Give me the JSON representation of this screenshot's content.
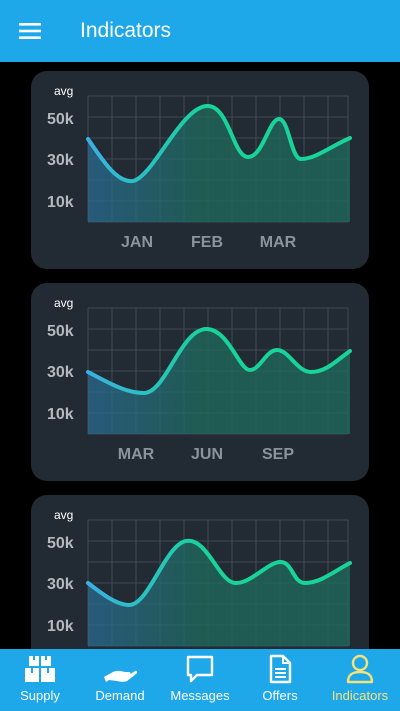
{
  "app": {
    "title": "Indicators"
  },
  "charts": [
    {
      "label": "avg",
      "ticks": [
        "50k",
        "30k",
        "10k"
      ],
      "months": [
        "JAN",
        "FEB",
        "MAR"
      ]
    },
    {
      "label": "avg",
      "ticks": [
        "50k",
        "30k",
        "10k"
      ],
      "months": [
        "MAR",
        "JUN",
        "SEP"
      ]
    },
    {
      "label": "avg",
      "ticks": [
        "50k",
        "30k",
        "10k"
      ],
      "months": []
    }
  ],
  "colors": {
    "appbar": "#1ea8ea",
    "card": "#222a33",
    "line_start": "#3bb0e2",
    "line_end": "#18d39a",
    "active_nav": "#f6e27a"
  },
  "nav": [
    {
      "label": "Supply",
      "icon": "boxes-icon"
    },
    {
      "label": "Demand",
      "icon": "hand-icon"
    },
    {
      "label": "Messages",
      "icon": "chat-bubble-icon"
    },
    {
      "label": "Offers",
      "icon": "document-icon"
    },
    {
      "label": "Indicators",
      "icon": "person-icon",
      "active": true
    }
  ]
}
